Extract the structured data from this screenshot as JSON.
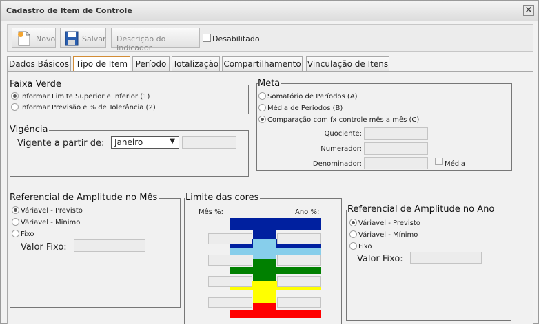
{
  "window": {
    "title": "Cadastro de Item de Controle"
  },
  "toolbar": {
    "novo_label": "Novo",
    "salvar_label": "Salvar",
    "descricao_label": "Descrição do Indicador",
    "desabilitado_label": "Desabilitado"
  },
  "tabs": [
    {
      "label": "Dados Básicos"
    },
    {
      "label": "Tipo de Item"
    },
    {
      "label": "Período"
    },
    {
      "label": "Totalização"
    },
    {
      "label": "Compartilhamento"
    },
    {
      "label": "Vinculação de Itens"
    }
  ],
  "faixa_verde": {
    "legend": "Faixa Verde",
    "options": [
      {
        "label": "Informar Limite Superior e Inferior (1)",
        "selected": true
      },
      {
        "label": "Informar Previsão e % de Tolerância (2)",
        "selected": false
      }
    ]
  },
  "vigencia": {
    "legend": "Vigência",
    "label": "Vigente a partir de:",
    "selected": "Janeiro"
  },
  "meta": {
    "legend": "Meta",
    "options": [
      {
        "label": "Somatório de Períodos (A)",
        "selected": false
      },
      {
        "label": "Média de Períodos (B)",
        "selected": false
      },
      {
        "label": "Comparação com fx controle mês a mês (C)",
        "selected": true
      }
    ],
    "quociente_label": "Quociente:",
    "numerador_label": "Numerador:",
    "denominador_label": "Denominador:",
    "media_label": "Média"
  },
  "ref_mes": {
    "legend": "Referencial de Amplitude no Mês",
    "options": [
      {
        "label": "Váriavel - Previsto",
        "selected": true
      },
      {
        "label": "Váriavel - Mínimo",
        "selected": false
      },
      {
        "label": "Fixo",
        "selected": false
      }
    ],
    "valor_fixo_label": "Valor Fixo:"
  },
  "limite_cores": {
    "legend": "Limite das cores",
    "mes_label": "Mês %:",
    "ano_label": "Ano %:",
    "colors": {
      "navy": "#00209f",
      "light_blue": "#87ceeb",
      "green": "#008000",
      "yellow": "#ffff00",
      "red": "#ff0000"
    }
  },
  "ref_ano": {
    "legend": "Referencial de Amplitude no Ano",
    "options": [
      {
        "label": "Váriavel - Previsto",
        "selected": true
      },
      {
        "label": "Váriavel - Mínimo",
        "selected": false
      },
      {
        "label": "Fixo",
        "selected": false
      }
    ],
    "valor_fixo_label": "Valor Fixo:"
  }
}
